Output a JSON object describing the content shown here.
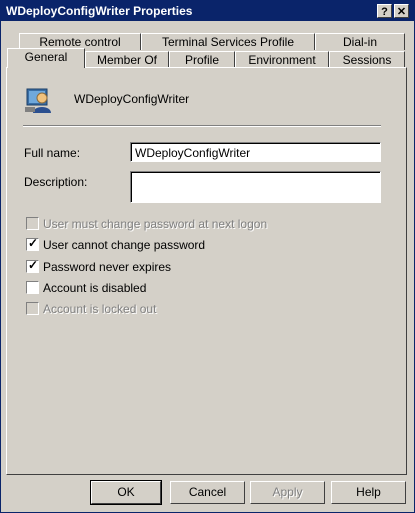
{
  "window": {
    "title": "WDeployConfigWriter Properties",
    "help_label": "?",
    "close_label": "✕"
  },
  "tabs_top": [
    {
      "label": "Remote control"
    },
    {
      "label": "Terminal Services Profile"
    },
    {
      "label": "Dial-in"
    }
  ],
  "tabs_bottom": [
    {
      "label": "General"
    },
    {
      "label": "Member Of"
    },
    {
      "label": "Profile"
    },
    {
      "label": "Environment"
    },
    {
      "label": "Sessions"
    }
  ],
  "general": {
    "user_display": "WDeployConfigWriter",
    "full_name_label": "Full name:",
    "full_name_value": "WDeployConfigWriter",
    "description_label": "Description:",
    "description_value": ""
  },
  "options": [
    {
      "label": "User must change password at next logon",
      "checked": false,
      "disabled": true
    },
    {
      "label": "User cannot change password",
      "checked": true,
      "disabled": false
    },
    {
      "label": "Password never expires",
      "checked": true,
      "disabled": false
    },
    {
      "label": "Account is disabled",
      "checked": false,
      "disabled": false
    },
    {
      "label": "Account is locked out",
      "checked": false,
      "disabled": true
    }
  ],
  "buttons": {
    "ok": "OK",
    "cancel": "Cancel",
    "apply": "Apply",
    "help": "Help"
  },
  "colors": {
    "titlebar": "#0a246a",
    "face": "#d4d0c8"
  },
  "icons": {
    "user": "user-icon"
  }
}
